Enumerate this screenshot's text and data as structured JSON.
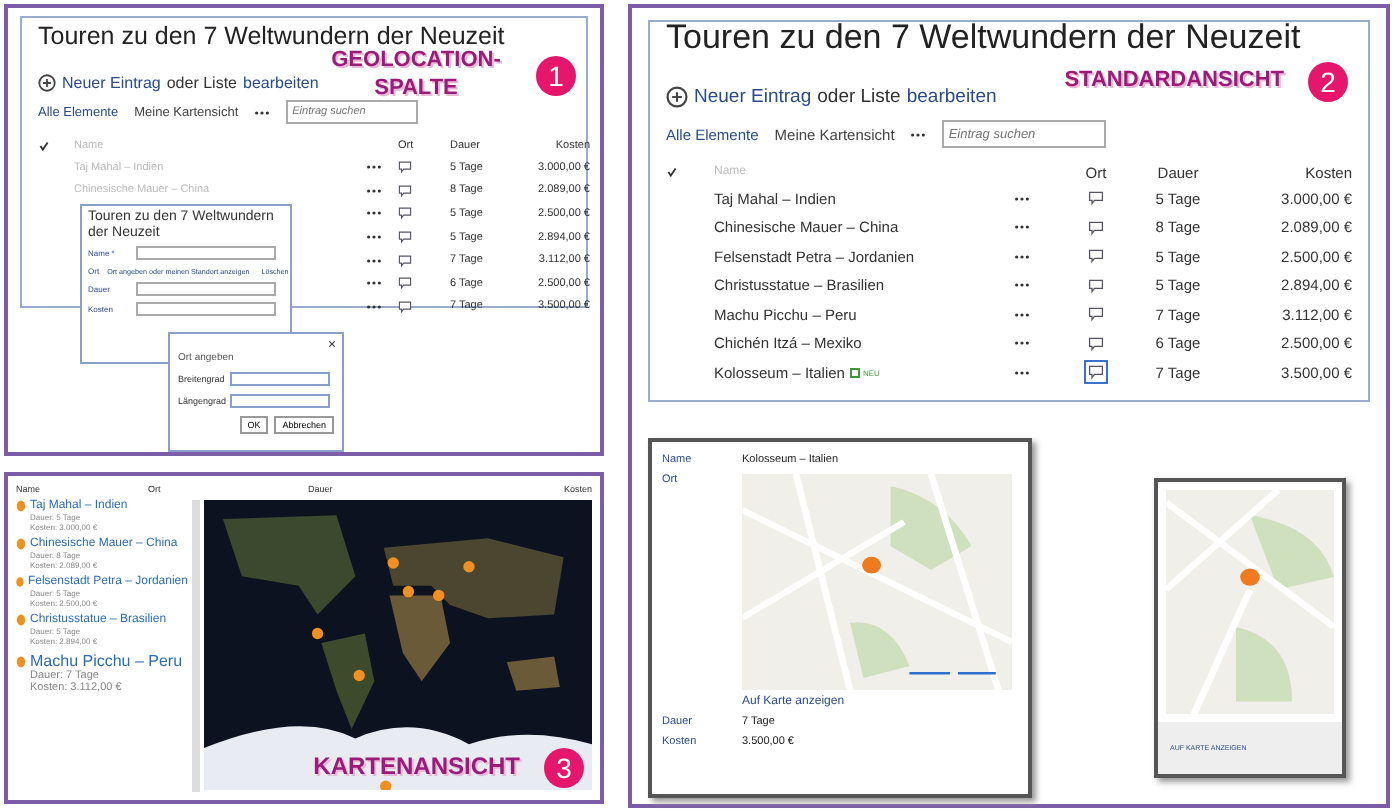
{
  "geolocation_panel": {
    "title": "Touren zu den 7 Weltwundern der Neuzeit",
    "badge": {
      "label": "GEOLOCATION-SPALTE",
      "number": "1"
    },
    "toolbar": [
      {
        "text": "Neuer Eintrag",
        "kind": "link"
      },
      {
        "text": "oder Liste",
        "kind": "plain"
      },
      {
        "text": "bearbeiten",
        "kind": "link"
      }
    ],
    "views": [
      {
        "label": "Alle Elemente",
        "selected": true
      },
      {
        "label": "Meine Kartensicht",
        "selected": false
      }
    ],
    "search": {
      "placeholder": "Eintrag suchen"
    },
    "columns": [
      "Name",
      "Ort",
      "Dauer",
      "Kosten"
    ],
    "rows": [
      {
        "name": "Taj Mahal – Indien",
        "duration": "5 Tage",
        "cost": "3.000,00 €"
      },
      {
        "name": "Chinesische Mauer – China",
        "duration": "8 Tage",
        "cost": "2.089,00 €"
      },
      {
        "duration": "5 Tage",
        "cost": "2.500,00 €"
      },
      {
        "duration": "5 Tage",
        "cost": "2.894,00 €"
      },
      {
        "duration": "7 Tage",
        "cost": "3.112,00 €"
      },
      {
        "duration": "6 Tage",
        "cost": "2.500,00 €"
      },
      {
        "duration": "7 Tage",
        "cost": "3.500,00 €"
      }
    ],
    "form": {
      "title": "Touren zu den 7 Weltwundern der Neuzeit",
      "fields": [
        {
          "label": "Name *",
          "kind": "input"
        },
        {
          "label": "Ort",
          "kind": "location",
          "link": "Ort angeben oder meinen Standort anzeigen",
          "action": "Löschen"
        },
        {
          "label": "Dauer",
          "kind": "input"
        },
        {
          "label": "Kosten",
          "kind": "input"
        }
      ]
    },
    "dialog": {
      "title": "Ort angeben",
      "fields": [
        {
          "label": "Breitengrad"
        },
        {
          "label": "Längengrad"
        }
      ],
      "buttons": [
        "OK",
        "Abbrechen"
      ]
    }
  },
  "standard_panel": {
    "title": "Touren zu den 7 Weltwundern der Neuzeit",
    "badge": {
      "label": "STANDARDANSICHT",
      "number": "2"
    },
    "toolbar": [
      {
        "text": "Neuer Eintrag",
        "kind": "link"
      },
      {
        "text": "oder Liste",
        "kind": "plain"
      },
      {
        "text": "bearbeiten",
        "kind": "link"
      }
    ],
    "views": [
      {
        "label": "Alle Elemente",
        "selected": true
      },
      {
        "label": "Meine Kartensicht",
        "selected": false
      }
    ],
    "search": {
      "placeholder": "Eintrag suchen"
    },
    "columns": [
      "Name",
      "Ort",
      "Dauer",
      "Kosten"
    ],
    "rows": [
      {
        "name": "Taj Mahal – Indien",
        "location_selected": false,
        "duration": "5 Tage",
        "cost": "3.000,00 €"
      },
      {
        "name": "Chinesische Mauer – China",
        "location_selected": false,
        "duration": "8 Tage",
        "cost": "2.089,00 €"
      },
      {
        "name": "Felsenstadt Petra – Jordanien",
        "location_selected": false,
        "duration": "5 Tage",
        "cost": "2.500,00 €"
      },
      {
        "name": "Christusstatue – Brasilien",
        "location_selected": false,
        "duration": "5 Tage",
        "cost": "2.894,00 €"
      },
      {
        "name": "Machu Picchu – Peru",
        "location_selected": false,
        "duration": "7 Tage",
        "cost": "3.112,00 €"
      },
      {
        "name": "Chichén Itzá – Mexiko",
        "location_selected": false,
        "duration": "6 Tage",
        "cost": "2.500,00 €"
      },
      {
        "name": "Kolosseum – Italien",
        "new_label": "NEU",
        "location_selected": true,
        "duration": "7 Tage",
        "cost": "3.500,00 €"
      }
    ],
    "detail": {
      "fields": [
        {
          "label": "Name",
          "value": "Kolosseum – Italien",
          "kind": "text"
        },
        {
          "label": "Ort",
          "link": "Auf Karte anzeigen",
          "kind": "map"
        },
        {
          "label": "Dauer",
          "value": "7 Tage",
          "kind": "text"
        },
        {
          "label": "Kosten",
          "value": "3.500,00 €",
          "kind": "text"
        }
      ]
    },
    "map_popup": {
      "link": "AUF KARTE ANZEIGEN"
    }
  },
  "map_panel": {
    "badge": {
      "label": "KARTENANSICHT",
      "number": "3"
    },
    "columns": [
      "Name",
      "Ort",
      "Dauer",
      "Kosten"
    ],
    "items": [
      {
        "name": "Taj Mahal – Indien",
        "duration": "Dauer: 5 Tage",
        "cost": "Kosten: 3.000,00 €",
        "emphasized": false
      },
      {
        "name": "Chinesische Mauer – China",
        "duration": "Dauer: 8 Tage",
        "cost": "Kosten: 2.089,00 €",
        "emphasized": false
      },
      {
        "name": "Felsenstadt Petra – Jordanien",
        "duration": "Dauer: 5 Tage",
        "cost": "Kosten: 2.500,00 €",
        "emphasized": false
      },
      {
        "name": "Christusstatue – Brasilien",
        "duration": "Dauer: 5 Tage",
        "cost": "Kosten: 2.894,00 €",
        "emphasized": false
      },
      {
        "name": "Machu Picchu – Peru",
        "duration": "Dauer: 7 Tage",
        "cost": "Kosten: 3.112,00 €",
        "emphasized": true
      }
    ]
  }
}
